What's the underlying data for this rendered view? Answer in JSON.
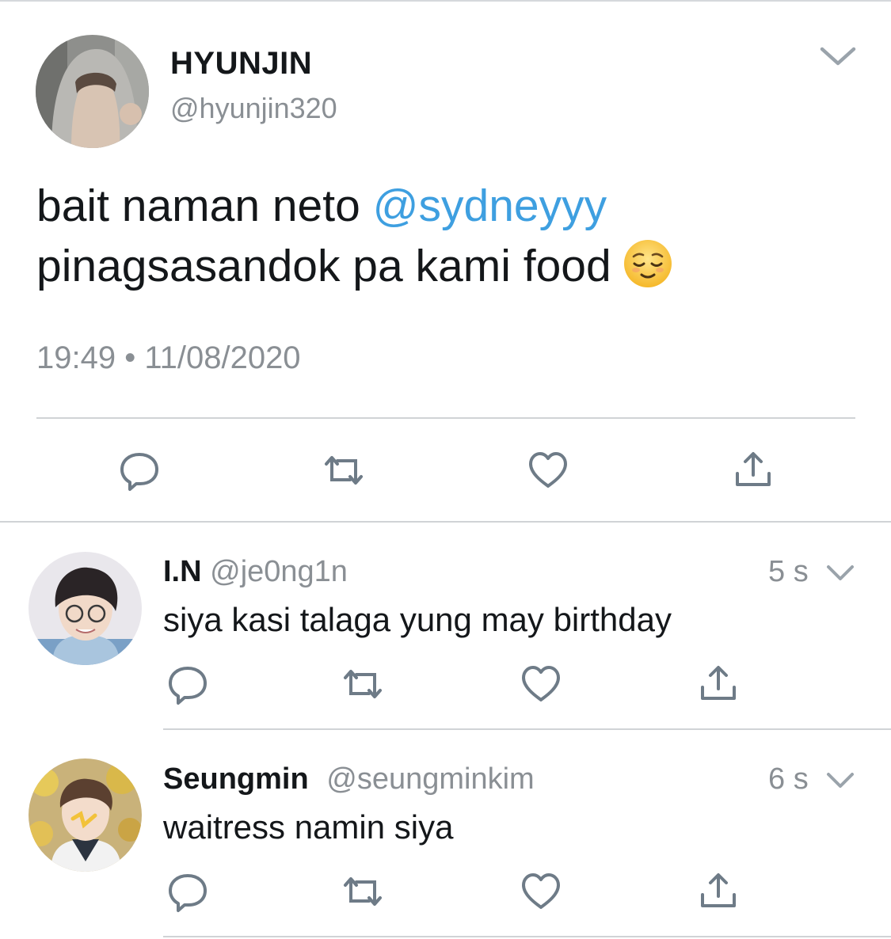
{
  "main_tweet": {
    "display_name": "HYUNJIN",
    "handle": "@hyunjin320",
    "text_part1": "bait naman neto ",
    "mention": "@sydneyyy",
    "text_part2": "pinagsasandok pa kami food",
    "emoji": "relieved-face-emoji",
    "timestamp": "19:49 • 11/08/2020"
  },
  "replies": [
    {
      "display_name": "I.N",
      "handle": "@je0ng1n",
      "time": "5 s",
      "text": "siya kasi talaga yung may birthday"
    },
    {
      "display_name": "Seungmin",
      "handle": "@seungminkim",
      "time": "6 s",
      "text": "waitress namin siya"
    }
  ],
  "actions": [
    "reply-icon",
    "retweet-icon",
    "like-icon",
    "share-icon"
  ],
  "colors": {
    "text": "#14171a",
    "secondary": "#8a8f94",
    "mention": "#3e9fe0",
    "icon": "#6e7b87",
    "divider": "#d0d3d6"
  }
}
